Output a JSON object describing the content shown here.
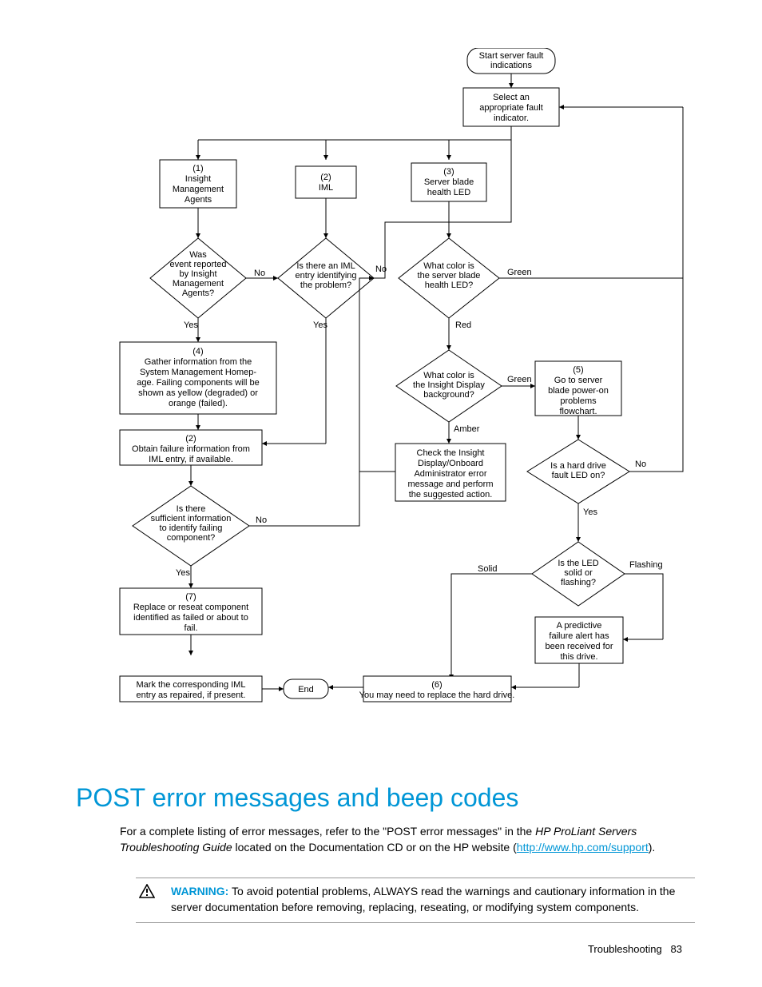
{
  "flowchart": {
    "start": "Start server fault indications",
    "select_indicator": "Select an appropriate fault indicator.",
    "n1": "(1)\nInsight\nManagement\nAgents",
    "n2": "(2)\nIML",
    "n3": "(3)\nServer blade\nhealth LED",
    "d_event": "Was\nevent reported\nby Insight\nManagement\nAgents?",
    "d_iml": "Is there an IML\nentry identifying\nthe problem?",
    "d_health": "What color is\nthe server blade\nhealth LED?",
    "n4": "(4)\nGather information from the\nSystem Management Homep-\nage. Failing components will be\nshown as yellow (degraded) or\norange (failed).",
    "n2b": "(2)\nObtain failure information from\nIML entry, if available.",
    "d_insight_bg": "What color is\nthe Insight Display\nbackground?",
    "n5": "(5)\nGo to server\nblade power-on\nproblems\nflowchart.",
    "n_check": "Check the Insight\nDisplay/Onboard\nAdministrator error\nmessage and perform\nthe suggested action.",
    "d_sufficient": "Is there\nsufficient information\nto identify failing\ncomponent?",
    "d_hd_led": "Is a hard drive\nfault LED on?",
    "d_solid": "Is the LED\nsolid or\nflashing?",
    "n7": "(7)\nReplace or reseat component\nidentified as failed or about to\nfail.",
    "n_mark": "Mark the corresponding IML\nentry as repaired, if present.",
    "end": "End",
    "n6": "(6)\nYou may need to replace the hard drive.",
    "n_predictive": "A predictive\nfailure alert has\nbeen received for\nthis drive.",
    "labels": {
      "yes": "Yes",
      "no": "No",
      "green": "Green",
      "red": "Red",
      "amber": "Amber",
      "solid": "Solid",
      "flashing": "Flashing"
    }
  },
  "heading": "POST error messages and beep codes",
  "body_pre": "For a complete listing of error messages, refer to the \"POST error messages\" in the ",
  "body_em": "HP ProLiant Servers Troubleshooting Guide",
  "body_mid": " located on the Documentation CD or on the HP website (",
  "body_link": "http://www.hp.com/support",
  "body_post": ").",
  "warning_label": "WARNING:",
  "warning_text": "  To avoid potential problems, ALWAYS read the warnings and cautionary information in the server documentation before removing, replacing, reseating, or modifying system components.",
  "footer_section": "Troubleshooting",
  "footer_page": "83"
}
